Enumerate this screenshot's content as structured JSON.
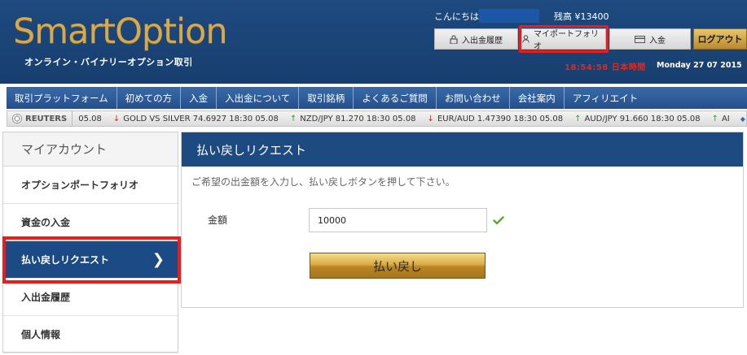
{
  "header": {
    "logo_text": "SmartOption",
    "tagline": "オンライン・バイナリーオプション取引",
    "greeting": "こんにちは",
    "balance": "残高 ¥13400",
    "buttons": {
      "history": "入出金履歴",
      "portfolio": "マイポートフォリオ",
      "deposit": "入金",
      "logout": "ログアウト"
    },
    "clock": "18:54:58 日本時間",
    "date": "Monday 27 07 2015"
  },
  "nav": {
    "items": [
      "取引プラットフォーム",
      "初めての方",
      "入金",
      "入出金について",
      "取引銘柄",
      "よくあるご質問",
      "お問い合わせ",
      "会社案内",
      "アフィリエイト"
    ]
  },
  "ticker": {
    "brand": "REUTERS",
    "items": [
      {
        "text": "05.08",
        "dir": "none"
      },
      {
        "text": "GOLD VS SILVER 74.6927 18:30 05.08",
        "dir": "down"
      },
      {
        "text": "NZD/JPY 81.270 18:30 05.08",
        "dir": "up"
      },
      {
        "text": "EUR/AUD 1.47390 18:30 05.08",
        "dir": "down"
      },
      {
        "text": "AUD/JPY 91.660 18:30 05.08",
        "dir": "up"
      },
      {
        "text": "AI",
        "dir": "up"
      }
    ]
  },
  "sidebar": {
    "title": "マイアカウント",
    "items": [
      {
        "label": "オプションポートフォリオ"
      },
      {
        "label": "資金の入金"
      },
      {
        "label": "払い戻しリクエスト"
      },
      {
        "label": "入出金履歴"
      },
      {
        "label": "個人情報"
      }
    ]
  },
  "main": {
    "title": "払い戻しリクエスト",
    "description": "ご希望の出金額を入力し、払い戻しボタンを押して下さい。",
    "amount_label": "金額",
    "amount_value": "10000",
    "submit_label": "払い戻し"
  },
  "colors": {
    "header_bg": "#1e4a80",
    "accent_gold": "#d9ab46",
    "highlight_red": "#ee1b1b",
    "active_blue": "#1b4a85"
  }
}
